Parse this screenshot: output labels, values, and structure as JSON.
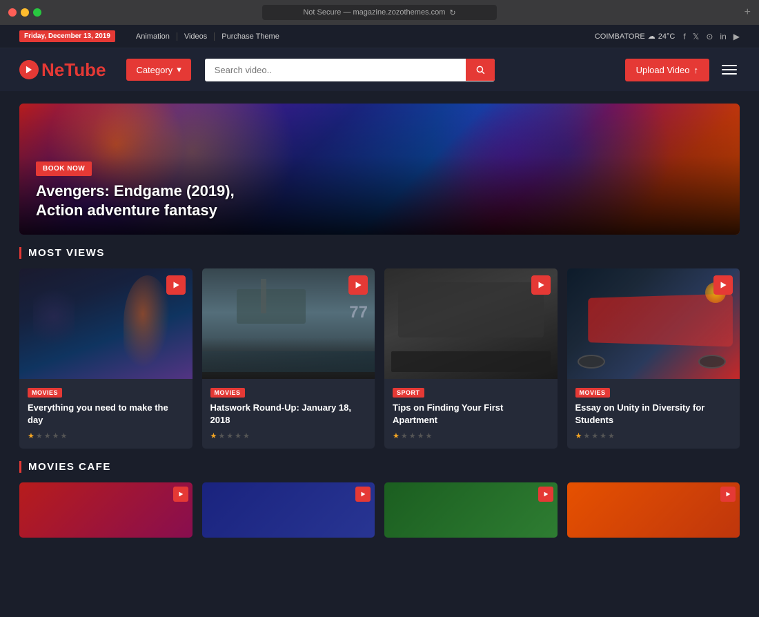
{
  "window": {
    "address": "Not Secure — magazine.zozothemes.com"
  },
  "topbar": {
    "date": "Friday, December 13, 2019",
    "nav_links": [
      "Animation",
      "Videos",
      "Purchase Theme"
    ],
    "weather": "COIMBATORE",
    "temp": "24°C",
    "social": [
      "f",
      "𝕏",
      "in",
      "📷",
      "in"
    ]
  },
  "header": {
    "logo_ne": "Ne",
    "logo_tube": "Tube",
    "category_label": "Category",
    "search_placeholder": "Search video..",
    "upload_label": "Upload Video"
  },
  "hero": {
    "book_now_label": "BOOK NOW",
    "title_line1": "Avengers: Endgame (2019),",
    "title_line2": "Action adventure fantasy"
  },
  "most_views": {
    "section_title": "MOST VIEWS",
    "cards": [
      {
        "category": "MOVIES",
        "title": "Everything you need to make the day",
        "stars": 1
      },
      {
        "category": "MOVIES",
        "title": "Hatswork Round-Up: January 18, 2018",
        "stars": 1
      },
      {
        "category": "SPORT",
        "title": "Tips on Finding Your First Apartment",
        "stars": 1
      },
      {
        "category": "MOVIES",
        "title": "Essay on Unity in Diversity for Students",
        "stars": 1
      }
    ]
  },
  "movies_cafe": {
    "section_title": "MOVIES CAFE"
  }
}
